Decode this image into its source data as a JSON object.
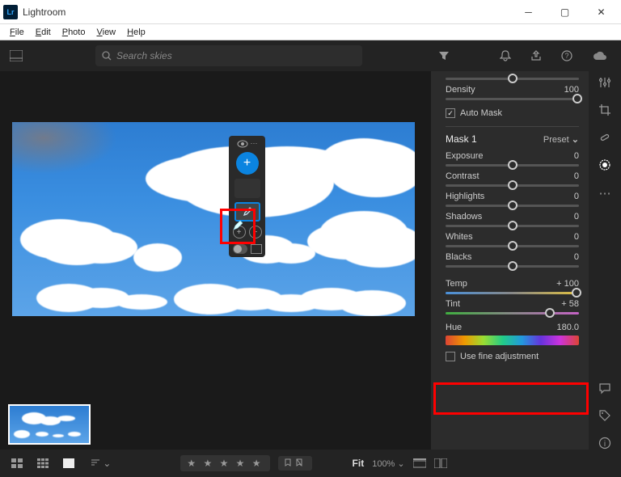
{
  "window": {
    "title": "Lightroom"
  },
  "menu": {
    "file": "File",
    "edit": "Edit",
    "photo": "Photo",
    "view": "View",
    "help": "Help"
  },
  "search": {
    "placeholder": "Search skies"
  },
  "masks": {
    "header": "Mask 1",
    "preset_label": "Preset",
    "auto_mask": "Auto Mask"
  },
  "panel": {
    "density": {
      "label": "Density",
      "value": "100",
      "pos": 100
    },
    "exposure": {
      "label": "Exposure",
      "value": "0",
      "pos": 50
    },
    "contrast": {
      "label": "Contrast",
      "value": "0",
      "pos": 50
    },
    "highlights": {
      "label": "Highlights",
      "value": "0",
      "pos": 50
    },
    "shadows": {
      "label": "Shadows",
      "value": "0",
      "pos": 50
    },
    "whites": {
      "label": "Whites",
      "value": "0",
      "pos": 50
    },
    "blacks": {
      "label": "Blacks",
      "value": "0",
      "pos": 50
    },
    "temp": {
      "label": "Temp",
      "value": "+ 100",
      "pos": 98
    },
    "tint": {
      "label": "Tint",
      "value": "+ 58",
      "pos": 78
    },
    "hue": {
      "label": "Hue",
      "value": "180.0"
    },
    "fine_adj": "Use fine adjustment"
  },
  "bottom": {
    "fit": "Fit",
    "zoom": "100%",
    "stars": "★ ★ ★ ★ ★"
  },
  "icons": {
    "add": "+",
    "minus": "−",
    "chevron": "⌄",
    "check": "✓",
    "bell": "🔔",
    "share": "⇪",
    "help": "?",
    "info": "ⓘ"
  }
}
